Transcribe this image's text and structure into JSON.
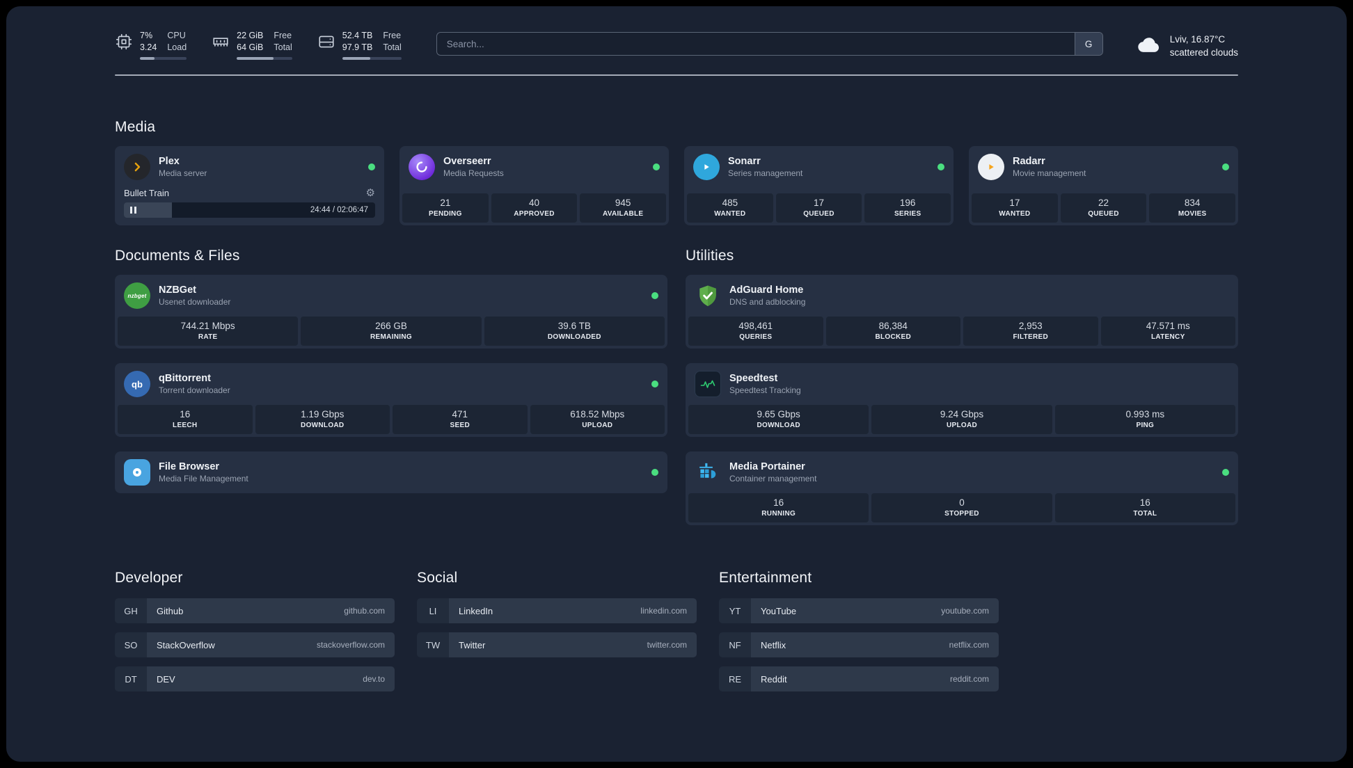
{
  "theme": {
    "page_bg": "#1a2232",
    "card_bg": "#263043",
    "stat_bg": "#1c2534",
    "status_online": "#4ade80",
    "plex_amber": "#e5a00d",
    "sonarr_blue": "#2fa7dc",
    "radarr_amber": "#f6a41c",
    "nzbget_green": "#3f9e43",
    "qbittorrent_blue": "#356ab2",
    "filebrowser_blue": "#49a4e0",
    "adguard_green": "#5fae4c",
    "speedtest_green": "#2ecc71",
    "portainer_blue": "#3fb9f3",
    "overseerr_purple": "#6d28d9"
  },
  "topbar": {
    "resources": [
      {
        "icon": "cpu-icon",
        "value_primary": "7%",
        "value_secondary": "3.24",
        "label_primary": "CPU",
        "label_secondary": "Load",
        "progress": 32
      },
      {
        "icon": "memory-icon",
        "value_primary": "22 GiB",
        "value_secondary": "64 GiB",
        "label_primary": "Free",
        "label_secondary": "Total",
        "progress": 66
      },
      {
        "icon": "disk-icon",
        "value_primary": "52.4 TB",
        "value_secondary": "97.9 TB",
        "label_primary": "Free",
        "label_secondary": "Total",
        "progress": 47
      }
    ],
    "search": {
      "placeholder": "Search...",
      "provider_label": "G"
    },
    "weather": {
      "icon": "cloud-icon",
      "location": "Lviv, 16.87°C",
      "condition": "scattered clouds"
    }
  },
  "sections": {
    "media": {
      "title": "Media"
    },
    "documents": {
      "title": "Documents & Files"
    },
    "utilities": {
      "title": "Utilities"
    }
  },
  "services": {
    "plex": {
      "name": "Plex",
      "desc": "Media server",
      "icon": "plex-icon",
      "online": true,
      "player": {
        "title": "Bullet Train",
        "time": "24:44 / 02:06:47",
        "progress": 19,
        "settings_icon": "gear-icon",
        "state_icon": "pause-icon"
      }
    },
    "overseerr": {
      "name": "Overseerr",
      "desc": "Media Requests",
      "icon": "overseerr-icon",
      "online": true,
      "stats": [
        {
          "value": "21",
          "label": "PENDING"
        },
        {
          "value": "40",
          "label": "APPROVED"
        },
        {
          "value": "945",
          "label": "AVAILABLE"
        }
      ]
    },
    "sonarr": {
      "name": "Sonarr",
      "desc": "Series management",
      "icon": "sonarr-icon",
      "online": true,
      "stats": [
        {
          "value": "485",
          "label": "WANTED"
        },
        {
          "value": "17",
          "label": "QUEUED"
        },
        {
          "value": "196",
          "label": "SERIES"
        }
      ]
    },
    "radarr": {
      "name": "Radarr",
      "desc": "Movie management",
      "icon": "radarr-icon",
      "online": true,
      "stats": [
        {
          "value": "17",
          "label": "WANTED"
        },
        {
          "value": "22",
          "label": "QUEUED"
        },
        {
          "value": "834",
          "label": "MOVIES"
        }
      ]
    },
    "nzbget": {
      "name": "NZBGet",
      "desc": "Usenet downloader",
      "icon": "nzbget-icon",
      "online": true,
      "stats": [
        {
          "value": "744.21 Mbps",
          "label": "RATE"
        },
        {
          "value": "266 GB",
          "label": "REMAINING"
        },
        {
          "value": "39.6 TB",
          "label": "DOWNLOADED"
        }
      ]
    },
    "qbittorrent": {
      "name": "qBittorrent",
      "desc": "Torrent downloader",
      "icon": "qbittorrent-icon",
      "online": true,
      "stats": [
        {
          "value": "16",
          "label": "LEECH"
        },
        {
          "value": "1.19 Gbps",
          "label": "DOWNLOAD"
        },
        {
          "value": "471",
          "label": "SEED"
        },
        {
          "value": "618.52 Mbps",
          "label": "UPLOAD"
        }
      ]
    },
    "filebrowser": {
      "name": "File Browser",
      "desc": "Media File Management",
      "icon": "filebrowser-icon",
      "online": true
    },
    "adguard": {
      "name": "AdGuard Home",
      "desc": "DNS and adblocking",
      "icon": "adguard-shield-icon",
      "online": false,
      "stats": [
        {
          "value": "498,461",
          "label": "QUERIES"
        },
        {
          "value": "86,384",
          "label": "BLOCKED"
        },
        {
          "value": "2,953",
          "label": "FILTERED"
        },
        {
          "value": "47.571 ms",
          "label": "LATENCY"
        }
      ]
    },
    "speedtest": {
      "name": "Speedtest",
      "desc": "Speedtest Tracking",
      "icon": "speedtest-graph-icon",
      "online": false,
      "stats": [
        {
          "value": "9.65 Gbps",
          "label": "DOWNLOAD"
        },
        {
          "value": "9.24 Gbps",
          "label": "UPLOAD"
        },
        {
          "value": "0.993 ms",
          "label": "PING"
        }
      ]
    },
    "portainer": {
      "name": "Media Portainer",
      "desc": "Container management",
      "icon": "portainer-crane-icon",
      "online": true,
      "stats": [
        {
          "value": "16",
          "label": "RUNNING"
        },
        {
          "value": "0",
          "label": "STOPPED"
        },
        {
          "value": "16",
          "label": "TOTAL"
        }
      ]
    }
  },
  "bookmarks": {
    "developer": {
      "title": "Developer",
      "items": [
        {
          "abbr": "GH",
          "name": "Github",
          "url": "github.com"
        },
        {
          "abbr": "SO",
          "name": "StackOverflow",
          "url": "stackoverflow.com"
        },
        {
          "abbr": "DT",
          "name": "DEV",
          "url": "dev.to"
        }
      ]
    },
    "social": {
      "title": "Social",
      "items": [
        {
          "abbr": "LI",
          "name": "LinkedIn",
          "url": "linkedin.com"
        },
        {
          "abbr": "TW",
          "name": "Twitter",
          "url": "twitter.com"
        }
      ]
    },
    "entertainment": {
      "title": "Entertainment",
      "items": [
        {
          "abbr": "YT",
          "name": "YouTube",
          "url": "youtube.com"
        },
        {
          "abbr": "NF",
          "name": "Netflix",
          "url": "netflix.com"
        },
        {
          "abbr": "RE",
          "name": "Reddit",
          "url": "reddit.com"
        }
      ]
    }
  }
}
